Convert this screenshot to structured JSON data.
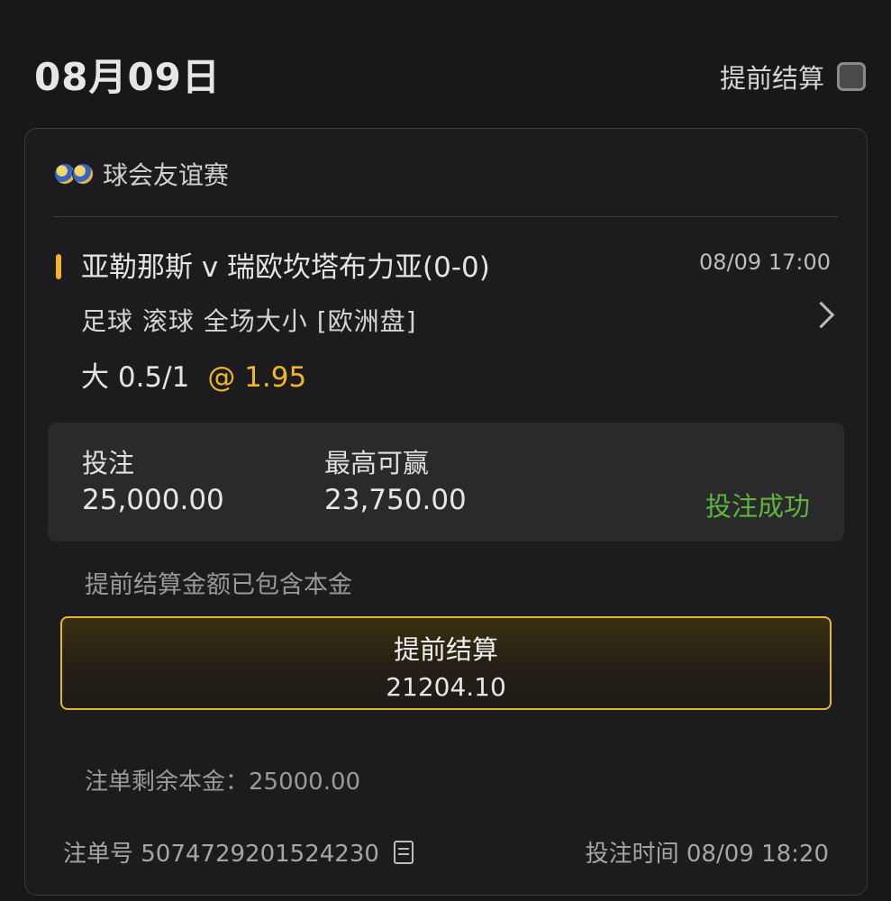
{
  "header": {
    "date": "08月09日",
    "early_settle_label": "提前结算"
  },
  "card": {
    "league": "球会友谊赛",
    "match": "亚勒那斯 v 瑞欧坎塔布力亚(0-0)",
    "match_time": "08/09 17:00",
    "market": "足球 滚球   全场大小 [欧洲盘]",
    "selection": "大 0.5/1",
    "odds": "@ 1.95",
    "stake_label": "投注",
    "stake_value": "25,000.00",
    "max_win_label": "最高可赢",
    "max_win_value": "23,750.00",
    "status": "投注成功",
    "note": "提前结算金额已包含本金",
    "settle_button_label": "提前结算",
    "settle_button_amount": "21204.10",
    "remaining_principal": "注单剩余本金：25000.00",
    "bet_id": "注单号 5074729201524230",
    "bet_time": "投注时间 08/09 18:20"
  },
  "colors": {
    "accent": "#f0b429",
    "success": "#5fb43b",
    "background": "#18181a"
  },
  "icons": {
    "league": "football-icon",
    "detail": "chevron-right-icon",
    "copy": "copy-icon"
  }
}
